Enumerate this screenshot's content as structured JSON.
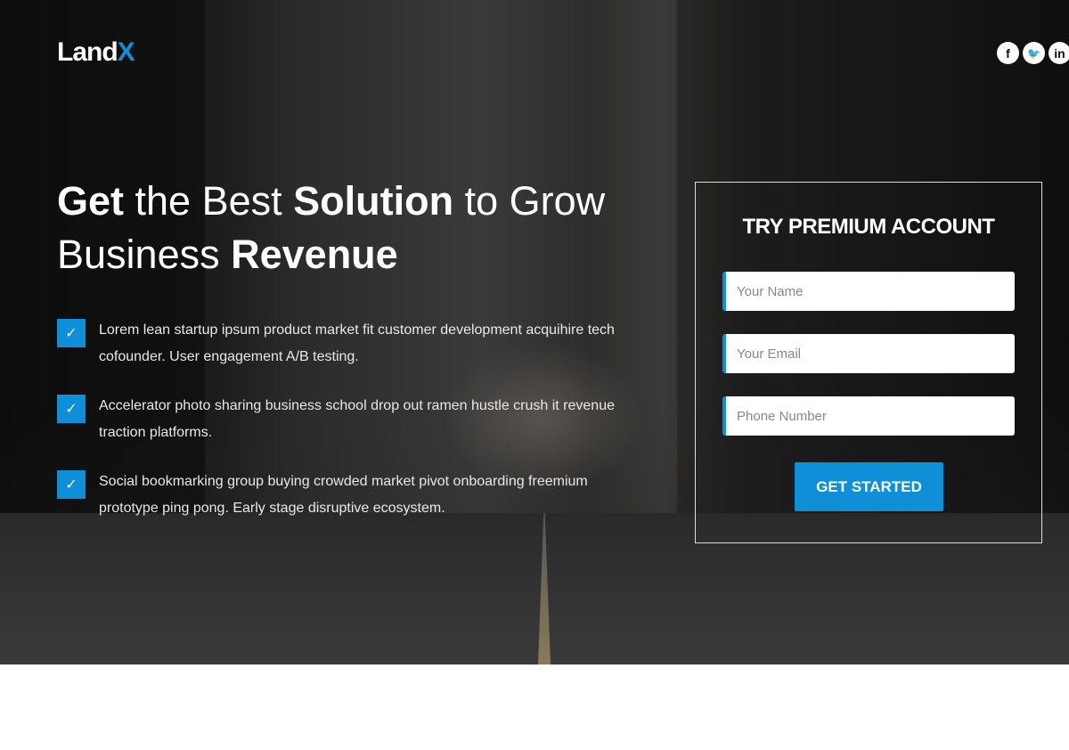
{
  "brand": {
    "logo_main": "Land",
    "logo_accent": "X",
    "accent": "#0f8fd8"
  },
  "social": [
    {
      "icon": "facebook-icon",
      "glyph": "f"
    },
    {
      "icon": "twitter-icon",
      "glyph": "🐦"
    },
    {
      "icon": "linkedin-icon",
      "glyph": "in"
    }
  ],
  "headline": {
    "w1": "Get",
    "w2": " the Best ",
    "w3": "Solution",
    "w4": " to Grow Business ",
    "w5": "Revenue"
  },
  "features": [
    "Lorem lean startup ipsum product market fit customer development acquihire tech cofounder. User engagement A/B testing.",
    "Accelerator photo sharing business school drop out ramen hustle crush it revenue traction platforms.",
    "Social bookmarking group buying crowded market pivot onboarding freemium prototype ping pong. Early stage disruptive ecosystem."
  ],
  "check_glyph": "✓",
  "form": {
    "title": "TRY PREMIUM ACCOUNT",
    "name_placeholder": "Your Name",
    "email_placeholder": "Your Email",
    "phone_placeholder": "Phone Number",
    "submit": "GET STARTED"
  }
}
